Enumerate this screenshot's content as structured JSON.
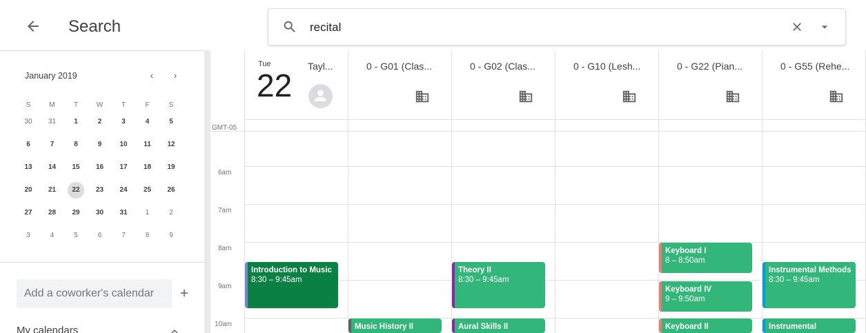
{
  "header": {
    "title": "Search",
    "search_value": "recital"
  },
  "mini_calendar": {
    "month_label": "January 2019",
    "prev_label": "‹",
    "next_label": "›",
    "dow": [
      "S",
      "M",
      "T",
      "W",
      "T",
      "F",
      "S"
    ],
    "weeks": [
      [
        "30",
        "31",
        "1",
        "2",
        "3",
        "4",
        "5"
      ],
      [
        "6",
        "7",
        "8",
        "9",
        "10",
        "11",
        "12"
      ],
      [
        "13",
        "14",
        "15",
        "16",
        "17",
        "18",
        "19"
      ],
      [
        "20",
        "21",
        "22",
        "23",
        "24",
        "25",
        "26"
      ],
      [
        "27",
        "28",
        "29",
        "30",
        "31",
        "1",
        "2"
      ],
      [
        "3",
        "4",
        "5",
        "6",
        "7",
        "8",
        "9"
      ]
    ],
    "selected_day": "22"
  },
  "sidebar": {
    "coworker_placeholder": "Add a coworker's calendar",
    "my_calendars_label": "My calendars"
  },
  "grid": {
    "timezone": "GMT-05",
    "times": [
      "6am",
      "7am",
      "8am",
      "9am",
      "10am"
    ],
    "day": {
      "dow": "Tue",
      "num": "22",
      "owner": "Tayl..."
    },
    "rooms": [
      "0 - G01 (Clas...",
      "0 - G02 (Clas...",
      "0 - G10 (Lesh...",
      "0 - G22 (Pian...",
      "0 - G55 (Rehe..."
    ]
  },
  "events": [
    {
      "title": "Introduction to Music",
      "time": "8:30 – 9:45am",
      "color": "#0b8043",
      "stripe": "#7986cb"
    },
    {
      "title": "Theory II",
      "time": "8:30 – 9:45am",
      "color": "#33b679",
      "stripe": "#8e24aa"
    },
    {
      "title": "Keyboard I",
      "time": "8 – 8:50am",
      "color": "#33b679",
      "stripe": "#e67c73"
    },
    {
      "title": "Keyboard IV",
      "time": "9 – 9:50am",
      "color": "#33b679",
      "stripe": "#e67c73"
    },
    {
      "title": "Instrumental Methods",
      "time": "8:30 – 9:45am",
      "color": "#33b679",
      "stripe": "#039be5"
    },
    {
      "title": "Music History II",
      "time": "",
      "color": "#33b679",
      "stripe": "#616161"
    },
    {
      "title": "Aural Skills II",
      "time": "",
      "color": "#33b679",
      "stripe": "#8e24aa"
    },
    {
      "title": "Keyboard II",
      "time": "",
      "color": "#33b679",
      "stripe": "#e67c73"
    },
    {
      "title": "Instrumental",
      "time": "",
      "color": "#33b679",
      "stripe": "#039be5"
    }
  ]
}
